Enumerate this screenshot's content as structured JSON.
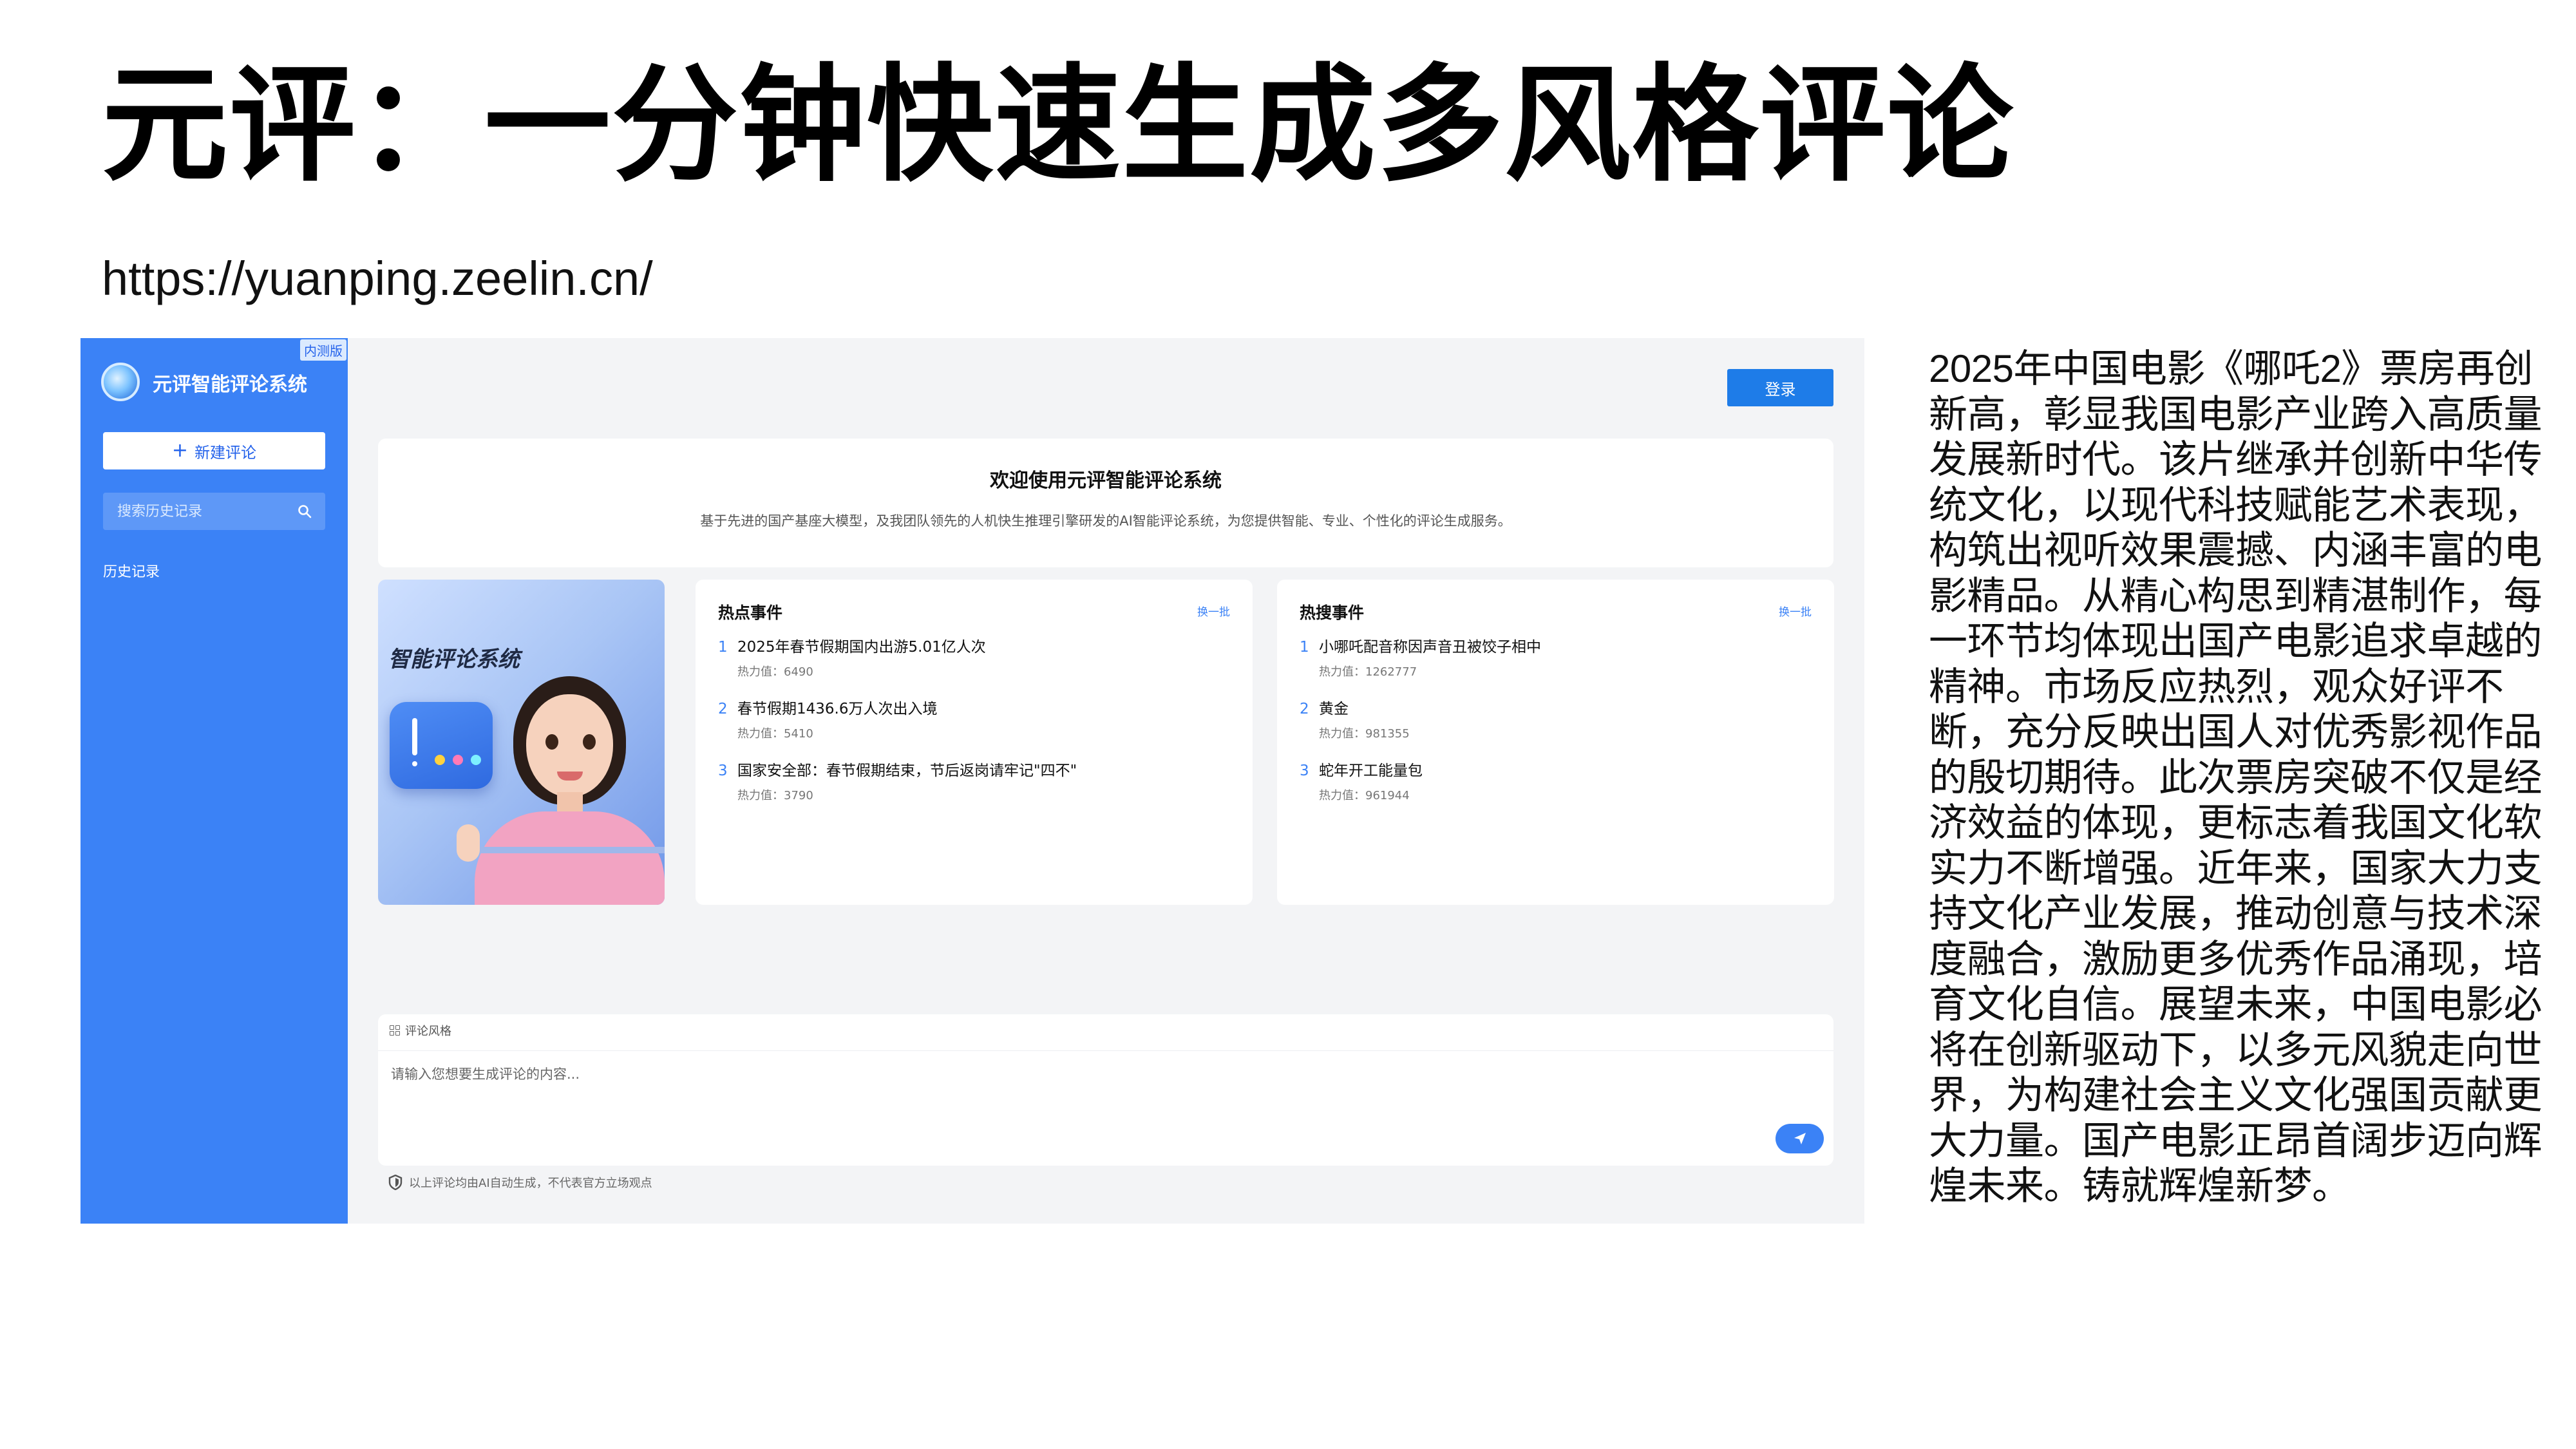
{
  "slide": {
    "title": "元评：一分钟快速生成多风格评论",
    "url": "https://yuanping.zeelin.cn/"
  },
  "app": {
    "sidebar": {
      "badge": "内测版",
      "title": "元评智能评论系统",
      "new_button": "新建评论",
      "search_placeholder": "搜索历史记录",
      "history_label": "历史记录"
    },
    "login_button": "登录",
    "welcome": {
      "title": "欢迎使用元评智能评论系统",
      "subtitle": "基于先进的国产基座大模型，及我团队领先的人机快生推理引擎研发的AI智能评论系统，为您提供智能、专业、个性化的评论生成服务。"
    },
    "hero_title": "智能评论系统",
    "hot_events": {
      "header": "热点事件",
      "refresh": "换一批",
      "items": [
        {
          "rank": "1",
          "title": "2025年春节假期国内出游5.01亿人次",
          "heat": "热力值：6490"
        },
        {
          "rank": "2",
          "title": "春节假期1436.6万人次出入境",
          "heat": "热力值：5410"
        },
        {
          "rank": "3",
          "title": "国家安全部：春节假期结束，节后返岗请牢记\"四不\"",
          "heat": "热力值：3790"
        }
      ]
    },
    "hot_searches": {
      "header": "热搜事件",
      "refresh": "换一批",
      "items": [
        {
          "rank": "1",
          "title": "小哪吒配音称因声音丑被饺子相中",
          "heat": "热力值：1262777"
        },
        {
          "rank": "2",
          "title": "黄金",
          "heat": "热力值：981355"
        },
        {
          "rank": "3",
          "title": "蛇年开工能量包",
          "heat": "热力值：961944"
        }
      ]
    },
    "input": {
      "style_label": "评论风格",
      "placeholder": "请输入您想要生成评论的内容..."
    },
    "disclaimer": "以上评论均由AI自动生成，不代表官方立场观点"
  },
  "article": "2025年中国电影《哪吒2》票房再创新高，彰显我国电影产业跨入高质量发展新时代。该片继承并创新中华传统文化，以现代科技赋能艺术表现，构筑出视听效果震撼、内涵丰富的电影精品。从精心构思到精湛制作，每一环节均体现出国产电影追求卓越的精神。市场反应热烈，观众好评不断，充分反映出国人对优秀影视作品的殷切期待。此次票房突破不仅是经济效益的体现，更标志着我国文化软实力不断增强。近年来，国家大力支持文化产业发展，推动创意与技术深度融合，激励更多优秀作品涌现，培育文化自信。展望未来，中国电影必将在创新驱动下，以多元风貌走向世界，为构建社会主义文化强国贡献更大力量。国产电影正昂首阔步迈向辉煌未来。铸就辉煌新梦。",
  "colors": {
    "sidebar": "#3b82f6",
    "accent": "#1e7ce8",
    "app_background": "#f3f4f6"
  }
}
